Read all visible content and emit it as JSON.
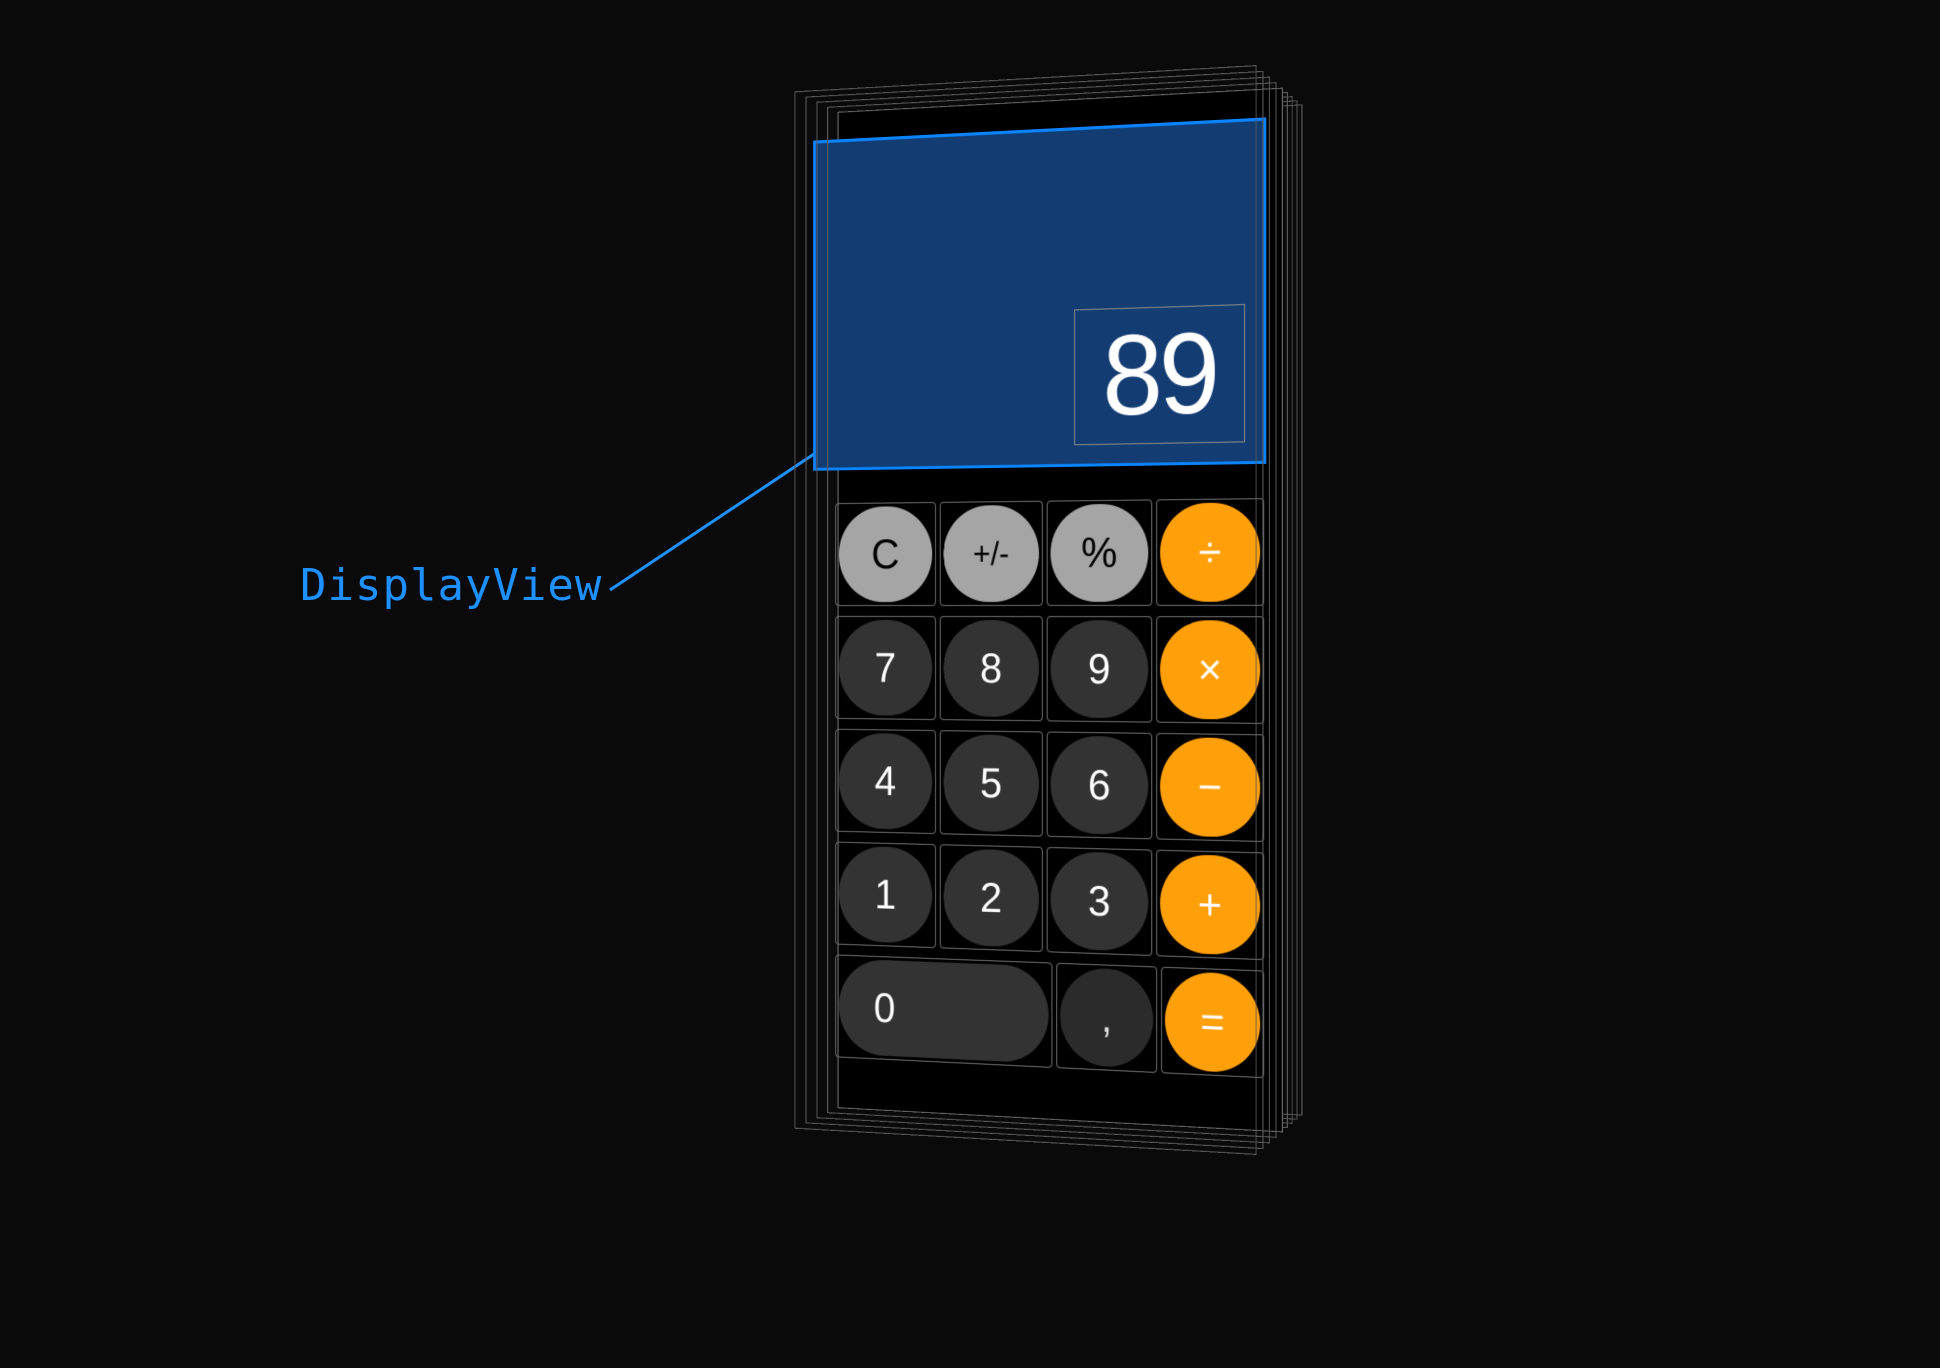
{
  "annotation": {
    "label": "DisplayView"
  },
  "display": {
    "value": "89"
  },
  "colors": {
    "accent_blue": "#0a84ff",
    "op_orange": "#ff9f0a",
    "fn_gray": "#a5a5a5",
    "digit_gray": "#333333"
  },
  "keys": {
    "row1": [
      "C",
      "+/-",
      "%",
      "÷"
    ],
    "row2": [
      "7",
      "8",
      "9",
      "×"
    ],
    "row3": [
      "4",
      "5",
      "6",
      "−"
    ],
    "row4": [
      "1",
      "2",
      "3",
      "+"
    ],
    "row5": [
      "0",
      ",",
      "="
    ]
  }
}
